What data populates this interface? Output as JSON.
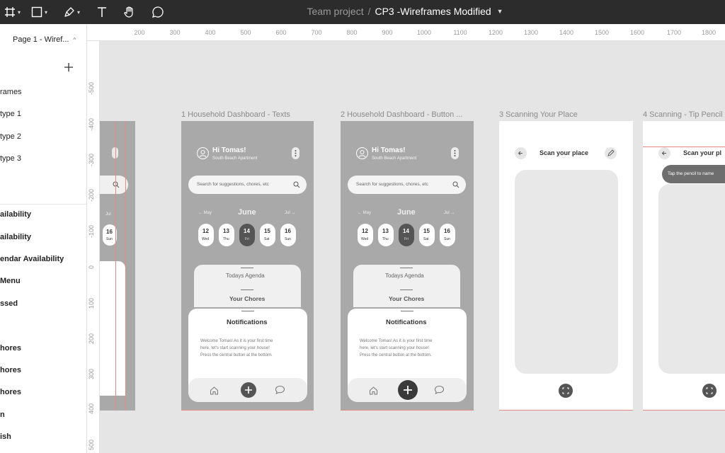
{
  "toolbar": {
    "team": "Team project",
    "separator": "/",
    "file": "CP3 -Wireframes Modified"
  },
  "sidebar": {
    "page": "Page 1 - Wiref...",
    "items": [
      "rames",
      "type 1",
      "type 2",
      "type 3",
      "ailability",
      "ailability",
      "endar Availability",
      "Menu",
      "ssed",
      "hores",
      "hores",
      "hores",
      "n",
      "ish"
    ]
  },
  "ruler": {
    "x": [
      "200",
      "300",
      "400",
      "500",
      "600",
      "700",
      "800",
      "900",
      "1000",
      "1100",
      "1200",
      "1300",
      "1400",
      "1500",
      "1600",
      "1700",
      "1800"
    ],
    "y": [
      "-500",
      "-400",
      "-300",
      "-200",
      "-100",
      "0",
      "100",
      "200",
      "300",
      "400",
      "500"
    ]
  },
  "frames": {
    "f1": {
      "label": "1 Household Dashboard - Texts",
      "greeting": "Hi Tomas!",
      "address": "South Beach Apartment",
      "search": "Search for suggestions, chores, etc",
      "month": "June",
      "prev": "May",
      "next": "Jul",
      "days": [
        {
          "n": "12",
          "d": "Wed"
        },
        {
          "n": "13",
          "d": "Thu"
        },
        {
          "n": "14",
          "d": "Fri"
        },
        {
          "n": "15",
          "d": "Sat"
        },
        {
          "n": "16",
          "d": "Sun"
        }
      ],
      "agenda": "Todays Agenda",
      "chores": "Your Chores",
      "notifications": "Notifications",
      "body": [
        "Welcome Tomas! As it is your first time",
        "here, let's start scanning your house!",
        "Press the central button at the bottom."
      ]
    },
    "f2": {
      "label": "2 Household Dashboard - Button ...",
      "greeting": "Hi Tomas!",
      "address": "South Beach Apartment",
      "search": "Search for suggestions, chores, etc",
      "month": "June",
      "prev": "May",
      "next": "Jul",
      "days": [
        {
          "n": "12",
          "d": "Wed"
        },
        {
          "n": "13",
          "d": "Thu"
        },
        {
          "n": "14",
          "d": "Fri"
        },
        {
          "n": "15",
          "d": "Sat"
        },
        {
          "n": "16",
          "d": "Sun"
        }
      ],
      "agenda": "Todays Agenda",
      "chores": "Your Chores",
      "notifications": "Notifications",
      "body": [
        "Welcome Tomas! As it is your first time",
        "here, let's start scanning your house!",
        "Press the central button at the bottom."
      ]
    },
    "f3": {
      "label": "3 Scanning Your Place",
      "title": "Scan your place"
    },
    "f4": {
      "label": "4 Scanning - Tip Pencil",
      "title": "Scan your pl",
      "tip": "Tap the pencil to name"
    },
    "f0": {
      "day": "16",
      "dayname": "Sun",
      "nav": "Jul"
    }
  }
}
